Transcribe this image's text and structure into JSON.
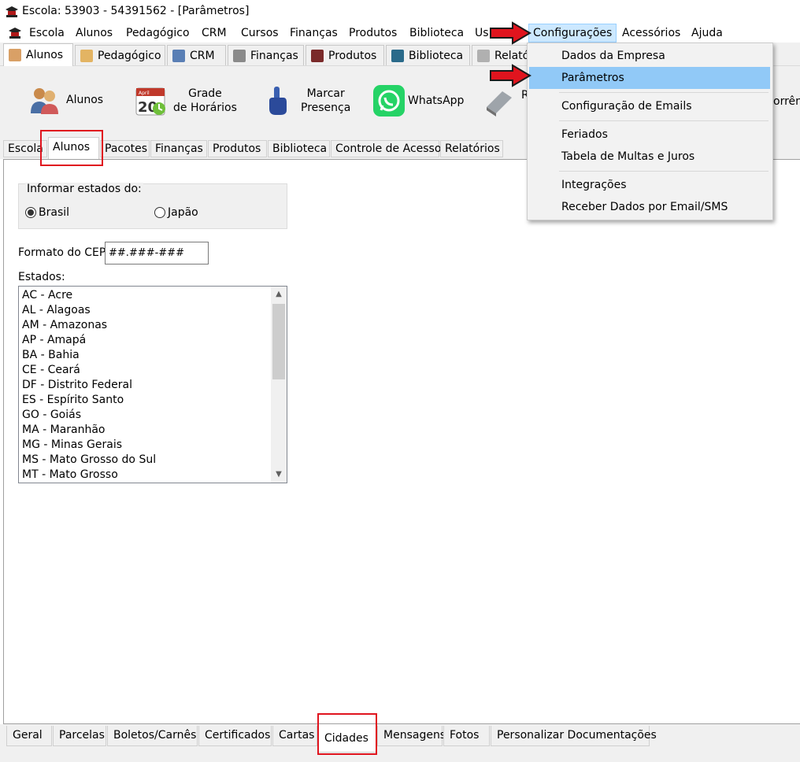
{
  "window": {
    "title": "Escola: 53903 - 54391562 - [Parâmetros]"
  },
  "menubar": {
    "items": [
      "Escola",
      "Alunos",
      "Pedagógico",
      "CRM",
      "Cursos",
      "Finanças",
      "Produtos",
      "Biblioteca",
      "Us",
      "Configurações",
      "Acessórios",
      "Ajuda"
    ],
    "active": "Configurações"
  },
  "shortcut_tabs": [
    "Alunos",
    "Pedagógico",
    "CRM",
    "Finanças",
    "Produtos",
    "Biblioteca",
    "Relató"
  ],
  "toolbar": {
    "buttons": [
      {
        "label": "Alunos",
        "icon": "students-icon"
      },
      {
        "label": "Grade\nde Horários",
        "icon": "calendar-icon",
        "calendar_number": "20",
        "calendar_month": "April"
      },
      {
        "label": "Marcar\nPresença",
        "icon": "pointing-hand-icon"
      },
      {
        "label": "WhatsApp",
        "icon": "whatsapp-icon"
      },
      {
        "label": "R",
        "icon": "report-icon"
      },
      {
        "label": "orrênc",
        "icon": "occurrence-icon"
      }
    ]
  },
  "module_tabs": [
    "Escola",
    "Alunos",
    "Pacotes",
    "Finanças",
    "Produtos",
    "Biblioteca",
    "Controle de Acesso",
    "Relatórios"
  ],
  "module_tabs_selected": "Alunos",
  "form": {
    "states_group_label": "Informar estados do:",
    "radio_brasil": "Brasil",
    "radio_japao": "Japão",
    "selected_radio": "Brasil",
    "cep_label": "Formato do CEP:",
    "cep_value": "##.###-###",
    "estados_label": "Estados:",
    "estados": [
      "AC - Acre",
      "AL - Alagoas",
      "AM - Amazonas",
      "AP - Amapá",
      "BA - Bahia",
      "CE - Ceará",
      "DF - Distrito Federal",
      "ES - Espírito Santo",
      "GO - Goiás",
      "MA - Maranhão",
      "MG - Minas Gerais",
      "MS - Mato Grosso do Sul",
      "MT - Mato Grosso"
    ]
  },
  "bottom_tabs": [
    "Geral",
    "Parcelas",
    "Boletos/Carnês",
    "Certificados",
    "Cartas",
    "Cidades",
    "Mensagens",
    "Fotos",
    "Personalizar Documentações"
  ],
  "bottom_tabs_selected": "Cidades",
  "dropdown": {
    "items": [
      "Dados da Empresa",
      "Parâmetros",
      "Configuração de Emails",
      "Feriados",
      "Tabela de Multas e Juros",
      "Integrações",
      "Receber Dados por Email/SMS"
    ],
    "highlighted": "Parâmetros"
  },
  "colors": {
    "menu_hover": "#cce8ff",
    "dropdown_highlight": "#91c9f7",
    "annotation_red": "#e0141e",
    "whatsapp_green": "#25d366"
  }
}
